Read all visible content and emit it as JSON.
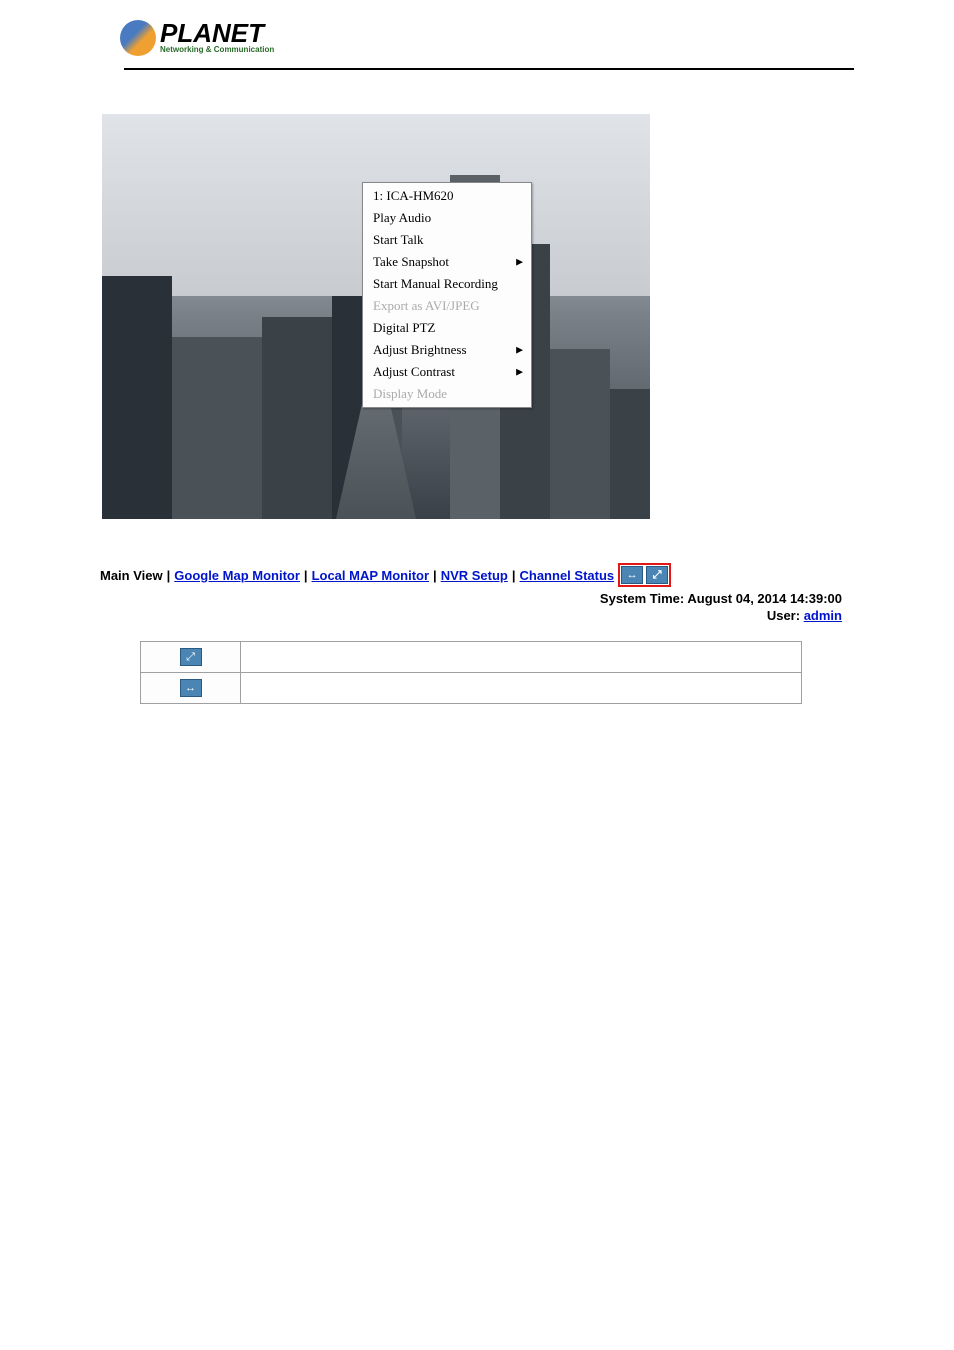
{
  "logo": {
    "brand": "PLANET",
    "tagline": "Networking & Communication"
  },
  "context_menu": {
    "items": [
      {
        "label": "1: ICA-HM620",
        "disabled": false,
        "submenu": false
      },
      {
        "label": "Play Audio",
        "disabled": false,
        "submenu": false
      },
      {
        "label": "Start Talk",
        "disabled": false,
        "submenu": false
      },
      {
        "label": "Take Snapshot",
        "disabled": false,
        "submenu": true
      },
      {
        "label": "Start Manual Recording",
        "disabled": false,
        "submenu": false
      },
      {
        "label": "Export as AVI/JPEG",
        "disabled": true,
        "submenu": false
      },
      {
        "label": "Digital PTZ",
        "disabled": false,
        "submenu": false
      },
      {
        "label": "Adjust Brightness",
        "disabled": false,
        "submenu": true
      },
      {
        "label": "Adjust Contrast",
        "disabled": false,
        "submenu": true
      },
      {
        "label": "Display Mode",
        "disabled": true,
        "submenu": false
      }
    ]
  },
  "nav": {
    "main_view": "Main View",
    "google_map": "Google Map Monitor",
    "local_map": "Local MAP Monitor",
    "nvr_setup": "NVR Setup",
    "channel_status": "Channel Status"
  },
  "system_time_label": "System Time:",
  "system_time": "August 04, 2014 14:39:00",
  "user_label": "User:",
  "user_name": "admin",
  "table": {
    "row1_desc": "",
    "row2_desc": ""
  }
}
